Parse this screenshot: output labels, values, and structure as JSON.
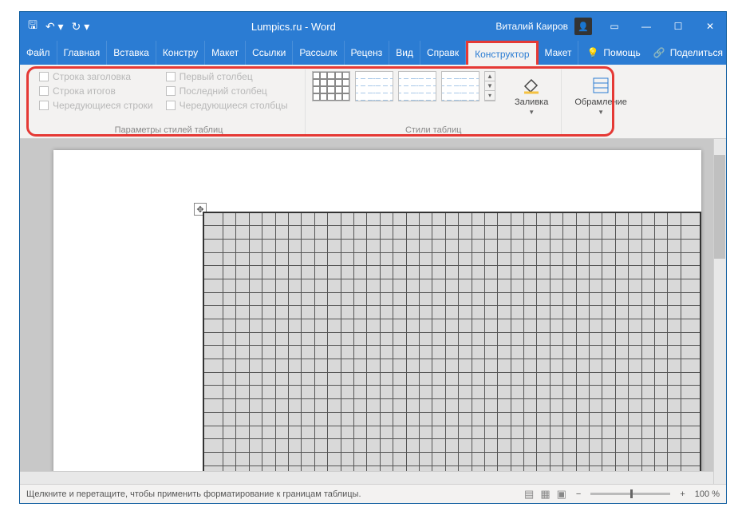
{
  "title": "Lumpics.ru  -  Word",
  "user": "Виталий Каиров",
  "tabs": [
    "Файл",
    "Главная",
    "Вставка",
    "Констру",
    "Макет",
    "Ссылки",
    "Рассылк",
    "Реценз",
    "Вид",
    "Справк",
    "Конструктор",
    "Макет"
  ],
  "active_tab": 10,
  "help_label": "Помощь",
  "share_label": "Поделиться",
  "ribbon": {
    "group1": {
      "label": "Параметры стилей таблиц",
      "col1": [
        "Строка заголовка",
        "Строка итогов",
        "Чередующиеся строки"
      ],
      "col2": [
        "Первый столбец",
        "Последний столбец",
        "Чередующиеся столбцы"
      ]
    },
    "group2": {
      "label": "Стили таблиц",
      "fill": "Заливка"
    },
    "group3": {
      "border": "Обрамление"
    }
  },
  "status": {
    "msg": "Щелкните и перетащите, чтобы применить форматирование к границам таблицы.",
    "zoom": "100 %"
  }
}
